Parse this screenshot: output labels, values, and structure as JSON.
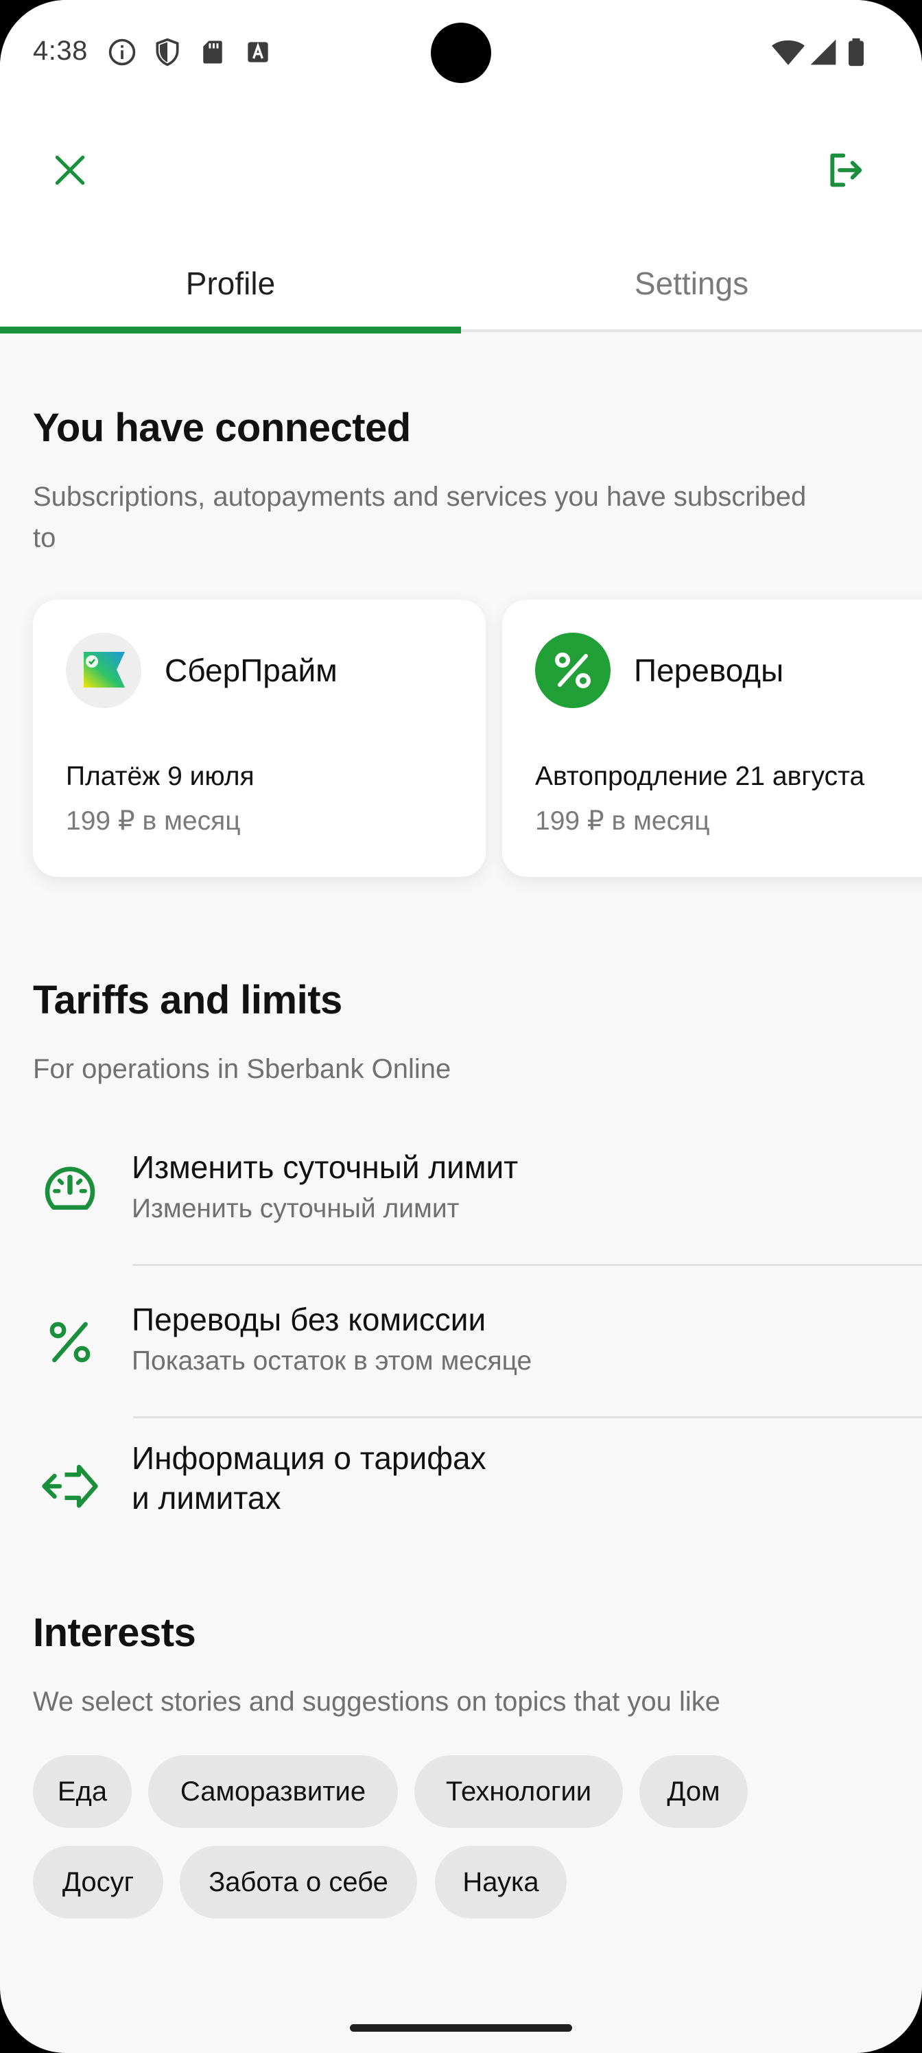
{
  "status_bar": {
    "time": "4:38",
    "left_icons": [
      "info-icon",
      "shield-icon",
      "sd-card-icon",
      "font-icon"
    ],
    "right_icons": [
      "wifi-icon",
      "cellular-signal-icon",
      "battery-icon"
    ]
  },
  "toolbar": {
    "close_icon": "close-icon",
    "logout_icon": "logout-icon"
  },
  "tabs": [
    {
      "label": "Profile",
      "active": true
    },
    {
      "label": "Settings",
      "active": false
    }
  ],
  "connected": {
    "title": "You have connected",
    "subtitle_line1": "Subscriptions, autopayments and services you have subscribed",
    "subtitle_line2": "to",
    "cards": [
      {
        "title": "СберПрайм",
        "line1": "Платёж 9 июля",
        "line2": "199 ₽ в месяц",
        "icon": "sberprime-logo-icon"
      },
      {
        "title": "Переводы",
        "line1": "Автопродление 21 августа",
        "line2": "199 ₽ в месяц",
        "icon": "percent-badge-icon"
      }
    ]
  },
  "tariffs": {
    "title": "Tariffs and limits",
    "subtitle": "For operations in Sberbank Online",
    "items": [
      {
        "title": "Изменить суточный лимит",
        "subtitle": "Изменить суточный лимит",
        "icon": "speedometer-icon"
      },
      {
        "title": "Переводы без комиссии",
        "subtitle": "Показать остаток в этом месяце",
        "icon": "percent-icon"
      },
      {
        "title_line1": "Информация о тарифах",
        "title_line2": "и лимитах",
        "icon": "transfer-arrows-icon"
      }
    ]
  },
  "interests": {
    "title": "Interests",
    "subtitle": "We select stories and suggestions on topics that you like",
    "chips": [
      "Еда",
      "Саморазвитие",
      "Технологии",
      "Дом",
      "Досуг",
      "Забота о себе",
      "Наука"
    ]
  },
  "colors": {
    "accent": "#1a8f3c",
    "background": "#f8f8f8",
    "chip": "#e6e6e6"
  }
}
